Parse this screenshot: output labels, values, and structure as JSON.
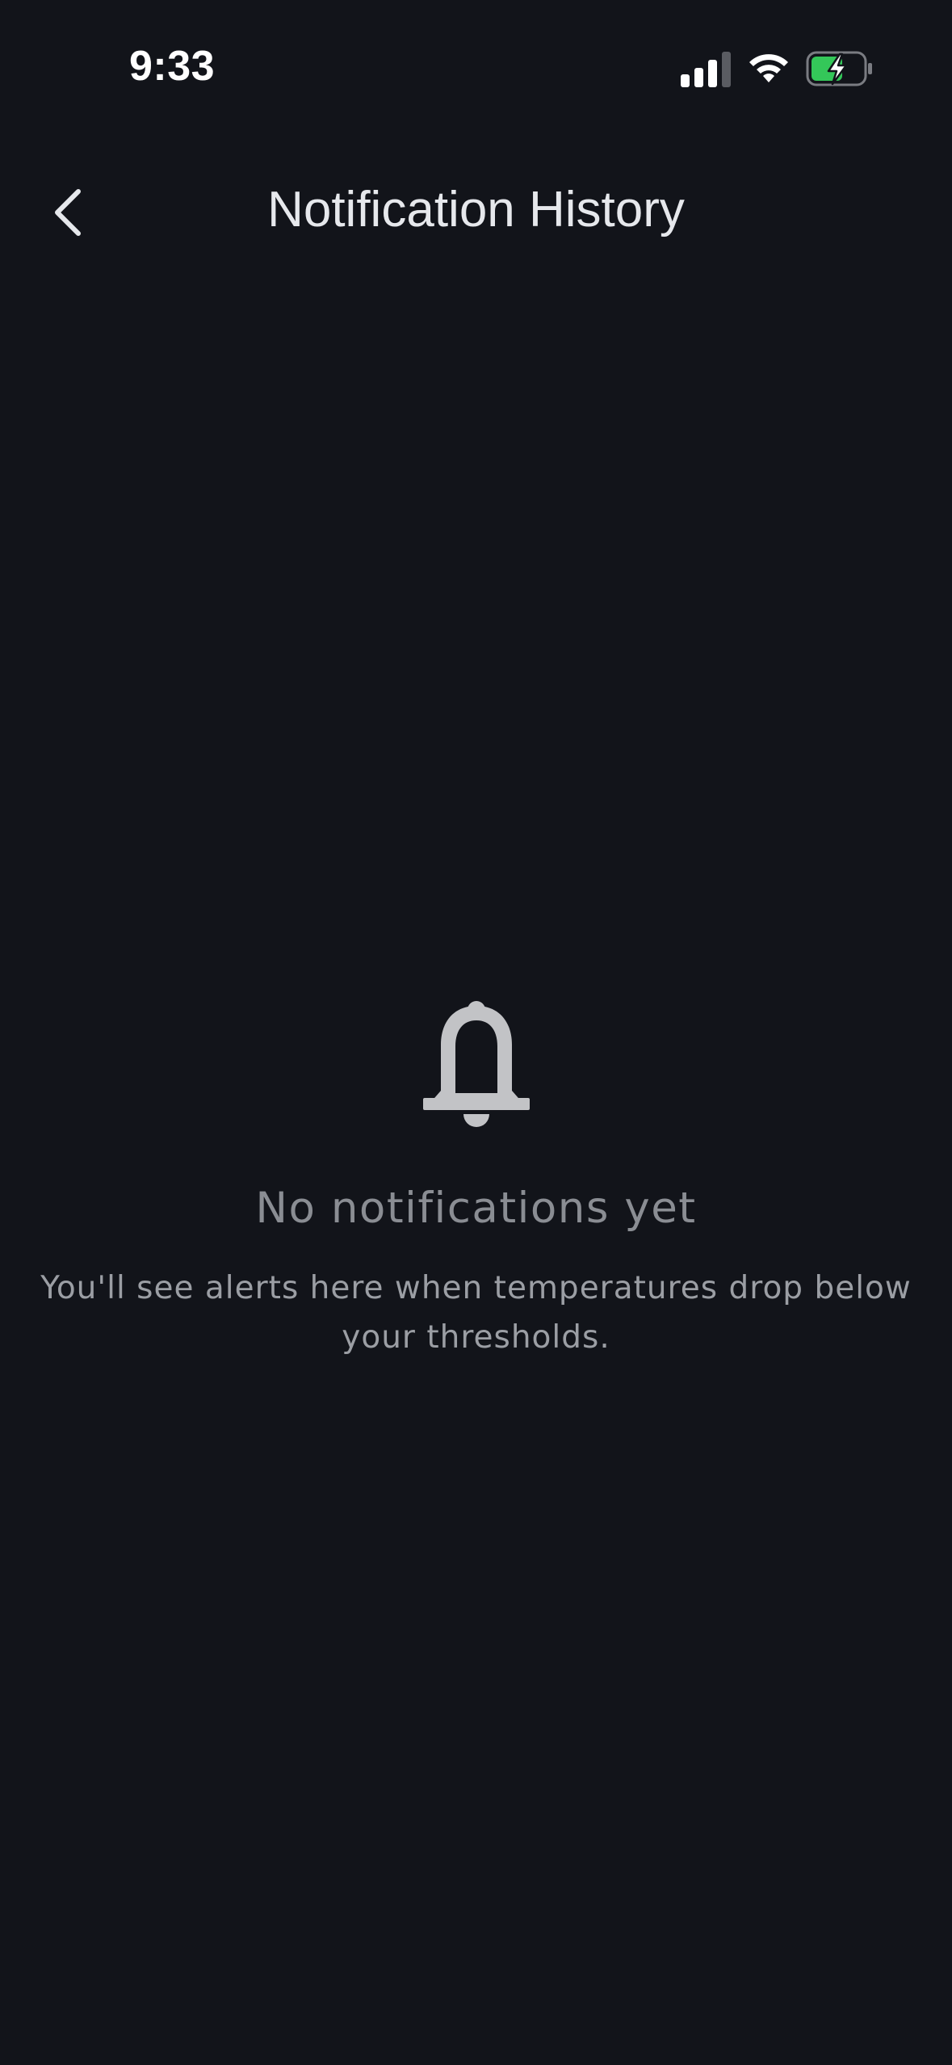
{
  "status_bar": {
    "time": "9:33",
    "signal_icon": "cellular-signal-icon",
    "wifi_icon": "wifi-icon",
    "battery_icon": "battery-charging-icon",
    "battery_color": "#34c759"
  },
  "nav": {
    "back_icon": "chevron-left-icon",
    "title": "Notification History"
  },
  "empty_state": {
    "icon": "bell-icon",
    "title": "No notifications yet",
    "message": "You'll see alerts here when temperatures drop below your thresholds."
  },
  "colors": {
    "background": "#12141a",
    "title_text": "#e6e8ec",
    "muted_text": "#8a8d93",
    "icon": "#c2c3c6"
  }
}
